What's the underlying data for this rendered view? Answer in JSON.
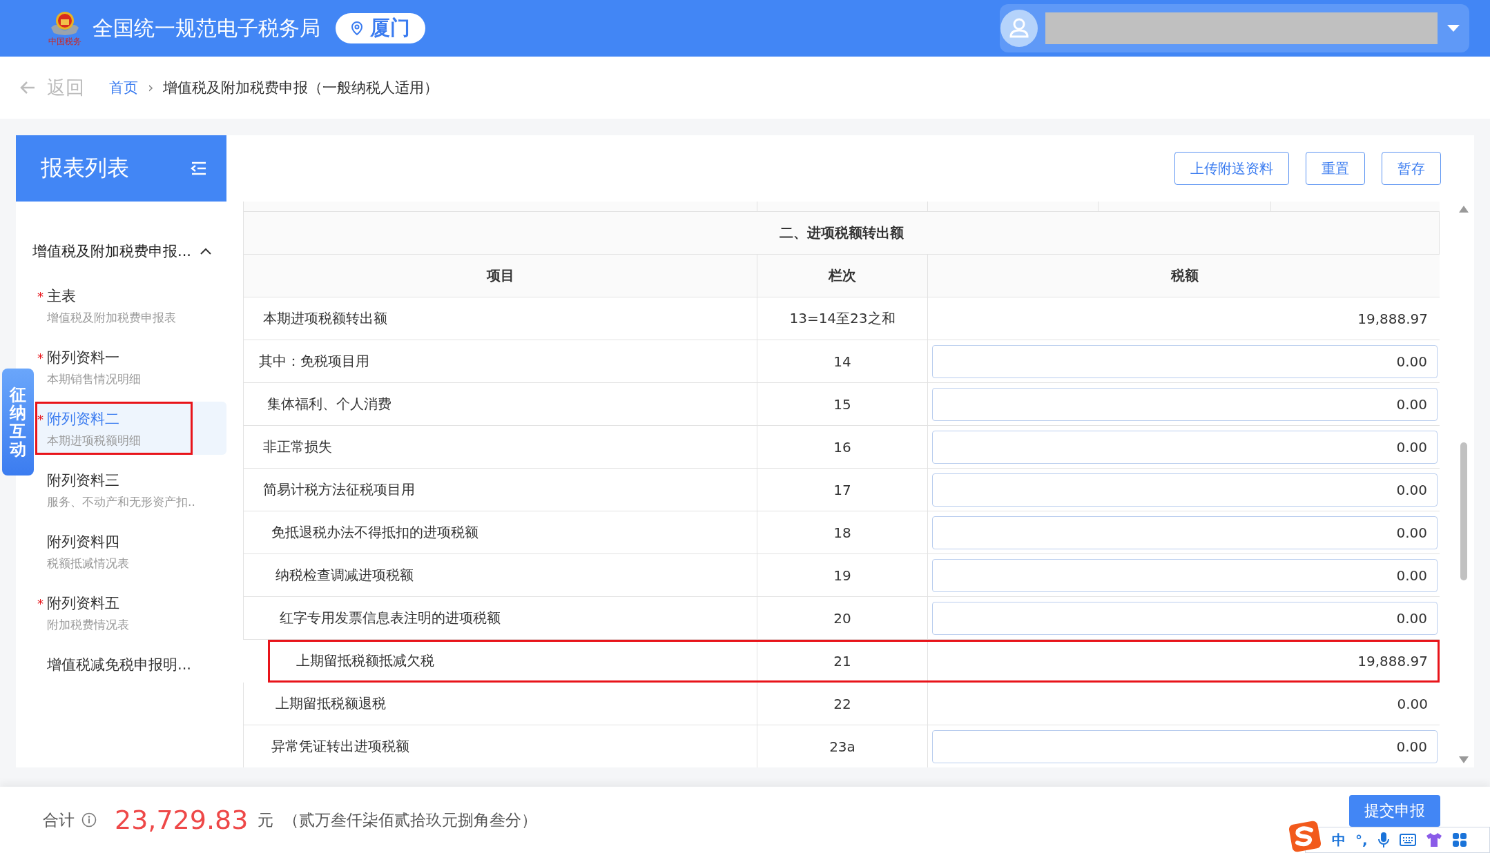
{
  "header": {
    "logo_caption": "中国税务",
    "title": "全国统一规范电子税务局",
    "location": "厦门"
  },
  "breadcrumb": {
    "back": "返回",
    "separator": "›",
    "items": [
      {
        "label": "首页",
        "kind": "link"
      },
      {
        "label": "增值税及附加税费申报（一般纳税人适用）",
        "kind": "current"
      }
    ]
  },
  "sidebar": {
    "title": "报表列表",
    "required_mark": "*",
    "group": {
      "label": "增值税及附加税费申报...",
      "expanded": true
    },
    "items": [
      {
        "title": "主表",
        "subtitle": "增值税及附加税费申报表",
        "required": true,
        "selected": false,
        "marked": false
      },
      {
        "title": "附列资料一",
        "subtitle": "本期销售情况明细",
        "required": true,
        "selected": false,
        "marked": false
      },
      {
        "title": "附列资料二",
        "subtitle": "本期进项税额明细",
        "required": true,
        "selected": true,
        "marked": true
      },
      {
        "title": "附列资料三",
        "subtitle": "服务、不动产和无形资产扣..",
        "required": false,
        "selected": false,
        "marked": false
      },
      {
        "title": "附列资料四",
        "subtitle": "税额抵减情况表",
        "required": false,
        "selected": false,
        "marked": false
      },
      {
        "title": "附列资料五",
        "subtitle": "附加税费情况表",
        "required": true,
        "selected": false,
        "marked": false
      },
      {
        "title": "增值税减免税申报明...",
        "required": false,
        "selected": false,
        "marked": false
      }
    ]
  },
  "side_tab": "征纳互动",
  "toolbar": [
    "上传附送资料",
    "重置",
    "暂存"
  ],
  "table": {
    "section_title": "二、进项税额转出额",
    "columns": [
      "项目",
      "栏次",
      "税额"
    ],
    "rows": [
      {
        "item": "本期进项税额转出额",
        "line": "13=14至23之和",
        "amount": "19,888.97",
        "kind": "value",
        "marked": false
      },
      {
        "item": "其中：免税项目用",
        "line": "14",
        "amount": "0.00",
        "kind": "input",
        "marked": false
      },
      {
        "item": "集体福利、个人消费",
        "line": "15",
        "amount": "0.00",
        "kind": "input",
        "marked": false
      },
      {
        "item": "非正常损失",
        "line": "16",
        "amount": "0.00",
        "kind": "input",
        "marked": false
      },
      {
        "item": "简易计税方法征税项目用",
        "line": "17",
        "amount": "0.00",
        "kind": "input",
        "marked": false
      },
      {
        "item": "免抵退税办法不得抵扣的进项税额",
        "line": "18",
        "amount": "0.00",
        "kind": "input",
        "marked": false
      },
      {
        "item": "纳税检查调减进项税额",
        "line": "19",
        "amount": "0.00",
        "kind": "input",
        "marked": false
      },
      {
        "item": "红字专用发票信息表注明的进项税额",
        "line": "20",
        "amount": "0.00",
        "kind": "input",
        "marked": false
      },
      {
        "item": "上期留抵税额抵减欠税",
        "line": "21",
        "amount": "19,888.97",
        "kind": "value",
        "marked": true
      },
      {
        "item": "上期留抵税额退税",
        "line": "22",
        "amount": "0.00",
        "kind": "value",
        "marked": false
      },
      {
        "item": "异常凭证转出进项税额",
        "line": "23a",
        "amount": "0.00",
        "kind": "input",
        "marked": false
      }
    ]
  },
  "footer": {
    "total_label": "合计",
    "total": "23,729.83",
    "unit": "元",
    "words": "（贰万叁仟柒佰贰拾玖元捌角叁分）",
    "submit": "提交申报"
  },
  "ime_toolbar": {
    "mode": "中",
    "punctuation": "°,"
  }
}
